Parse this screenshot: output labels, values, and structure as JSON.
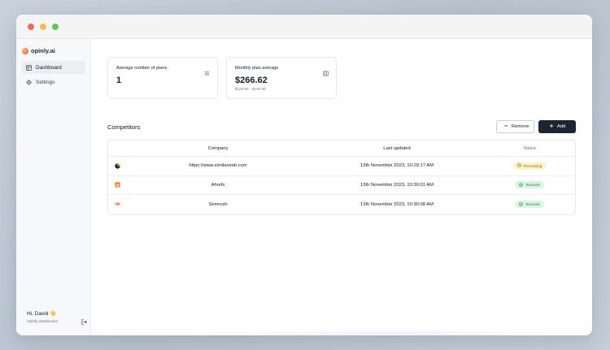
{
  "window": {
    "traffic_lights": [
      {
        "name": "close",
        "color": "#ee6a5f"
      },
      {
        "name": "minimize",
        "color": "#f5be4f"
      },
      {
        "name": "maximize",
        "color": "#62c554"
      }
    ]
  },
  "sidebar": {
    "brand": "opinly.ai",
    "items": [
      {
        "label": "Dashboard",
        "icon": "dashboard-icon",
        "active": true
      },
      {
        "label": "Settings",
        "icon": "gear-icon",
        "active": false
      }
    ],
    "user": {
      "greeting": "Hi, David 👋",
      "subtitle": "Opinly dashboard"
    }
  },
  "cards": [
    {
      "label": "Average number of plans",
      "value": "1",
      "range": "",
      "icon": "list-icon"
    },
    {
      "label": "Monthly plan average",
      "value": "$266.62",
      "range": "$119.90 - $449.90",
      "icon": "columns-icon"
    }
  ],
  "competitors": {
    "title": "Competitors",
    "remove_label": "Remove",
    "add_label": "Add",
    "columns": [
      "Company",
      "Last updated",
      "Status"
    ],
    "rows": [
      {
        "logo": "similarweb-logo-icon",
        "company": "https://www.similarweb.com",
        "updated": "13th November 2023, 10:29:17 AM",
        "status": "Processing"
      },
      {
        "logo": "ahrefs-logo-icon",
        "company": "Ahrefs",
        "updated": "13th November 2023, 10:30:01 AM",
        "status": "Success"
      },
      {
        "logo": "semrush-logo-icon",
        "company": "Semrush",
        "updated": "13th November 2023, 10:30:08 AM",
        "status": "Success"
      }
    ]
  },
  "colors": {
    "accent_dark": "#1e2532",
    "processing": "#a16207",
    "success": "#15803d",
    "brand": "#e8622a"
  }
}
